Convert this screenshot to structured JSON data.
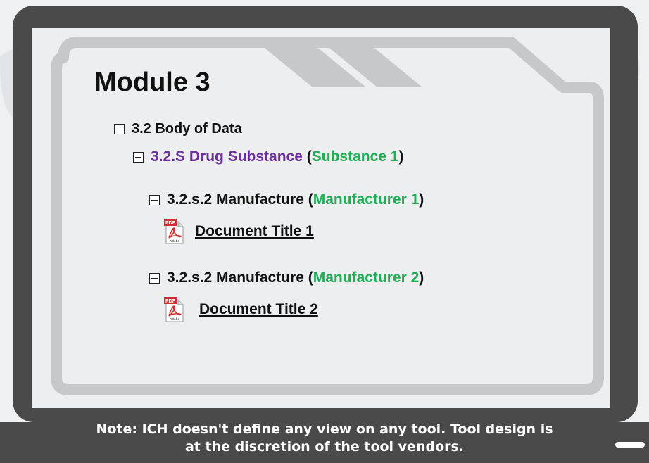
{
  "module_title": "Module 3",
  "tree": {
    "body_of_data": "3.2 Body of Data",
    "drug_substance": {
      "label": "3.2.S Drug Substance",
      "open": "(",
      "substance": "Substance 1",
      "close": ")"
    },
    "manufacture_1": {
      "label": "3.2.s.2 Manufacture",
      "open": "(",
      "manufacturer": "Manufacturer 1",
      "close": ")",
      "document": "Document Title 1"
    },
    "manufacture_2": {
      "label": "3.2.s.2 Manufacture",
      "open": "(",
      "manufacturer": "Manufacturer 2",
      "close": ")",
      "document": "Document Title 2"
    }
  },
  "pdf_icon": {
    "badge": "PDF",
    "brand": "Adobe"
  },
  "note": {
    "line1": "Note: ICH doesn't define any view on any tool.  Tool design is",
    "line2": "at the discretion of the tool vendors."
  },
  "colors": {
    "monitor": "#4a4a4a",
    "purple": "#6a2e9e",
    "green": "#1fae55",
    "folder": "#c6c8ca"
  }
}
